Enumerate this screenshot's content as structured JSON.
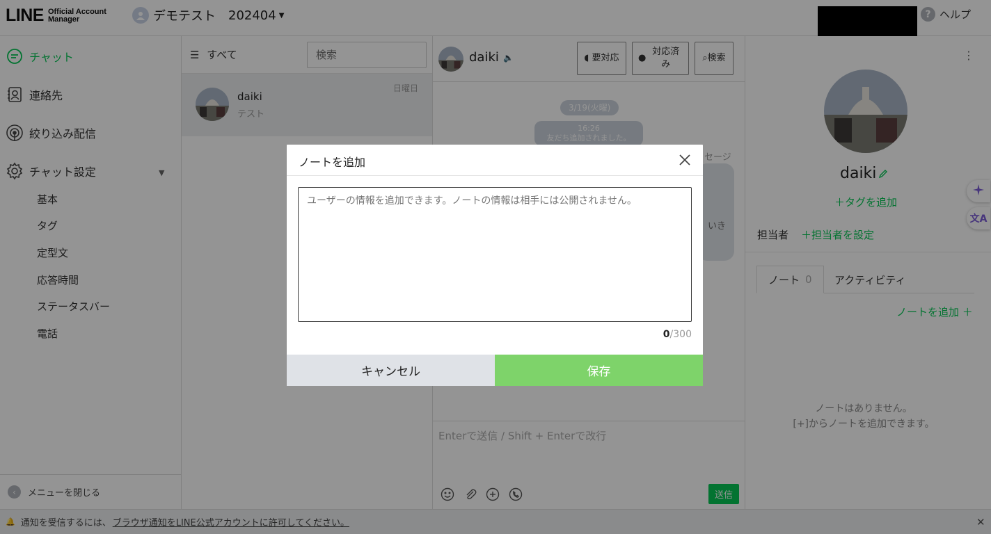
{
  "header": {
    "logo_main": "LINE",
    "logo_sub_line1": "Official Account",
    "logo_sub_line2": "Manager",
    "account_name": "デモテスト",
    "account_id": "202404",
    "help_label": "ヘルプ"
  },
  "sidebar": {
    "items": [
      {
        "label": "チャット",
        "icon": "chat-icon"
      },
      {
        "label": "連絡先",
        "icon": "contact-icon"
      },
      {
        "label": "絞り込み配信",
        "icon": "broadcast-icon"
      },
      {
        "label": "チャット設定",
        "icon": "gear-icon"
      }
    ],
    "sub_items": [
      "基本",
      "タグ",
      "定型文",
      "応答時間",
      "ステータスバー",
      "電話"
    ],
    "close_menu_label": "メニューを閉じる"
  },
  "chatlist": {
    "filter_label": "すべて",
    "search_placeholder": "検索",
    "rows": [
      {
        "name": "daiki",
        "preview": "テスト",
        "date": "日曜日"
      }
    ]
  },
  "chat": {
    "user_name": "daiki",
    "buttons": {
      "needs_action": "要対応",
      "done": "対応済み",
      "search": "検索"
    },
    "date_pill": "3/19(火曜)",
    "system_time": "16:26",
    "system_text": "友だち追加されました。",
    "message_label_partial": "セージ",
    "message_partial": "いき",
    "composer_placeholder": "Enterで送信 / Shift + Enterで改行",
    "send_label": "送信"
  },
  "profile": {
    "name": "daiki",
    "add_tag": "タグを追加",
    "assignee_label": "担当者",
    "assignee_set": "担当者を設定",
    "tabs": [
      {
        "label": "ノート",
        "count": "0"
      },
      {
        "label": "アクティビティ"
      }
    ],
    "add_note": "ノートを追加",
    "empty_line1": "ノートはありません。",
    "empty_line2": "[+]からノートを追加できます。"
  },
  "bottombar": {
    "text": "通知を受信するには、",
    "link": "ブラウザ通知をLINE公式アカウントに許可してください。"
  },
  "modal": {
    "title": "ノートを追加",
    "placeholder": "ユーザーの情報を追加できます。ノートの情報は相手には公開されません。",
    "count_current": "0",
    "count_max": "/300",
    "cancel_label": "キャンセル",
    "save_label": "保存"
  },
  "colors": {
    "brand_green": "#06c755",
    "save_green_disabled": "#7ed36a",
    "overlay": "rgba(0,0,0,0.42)"
  }
}
